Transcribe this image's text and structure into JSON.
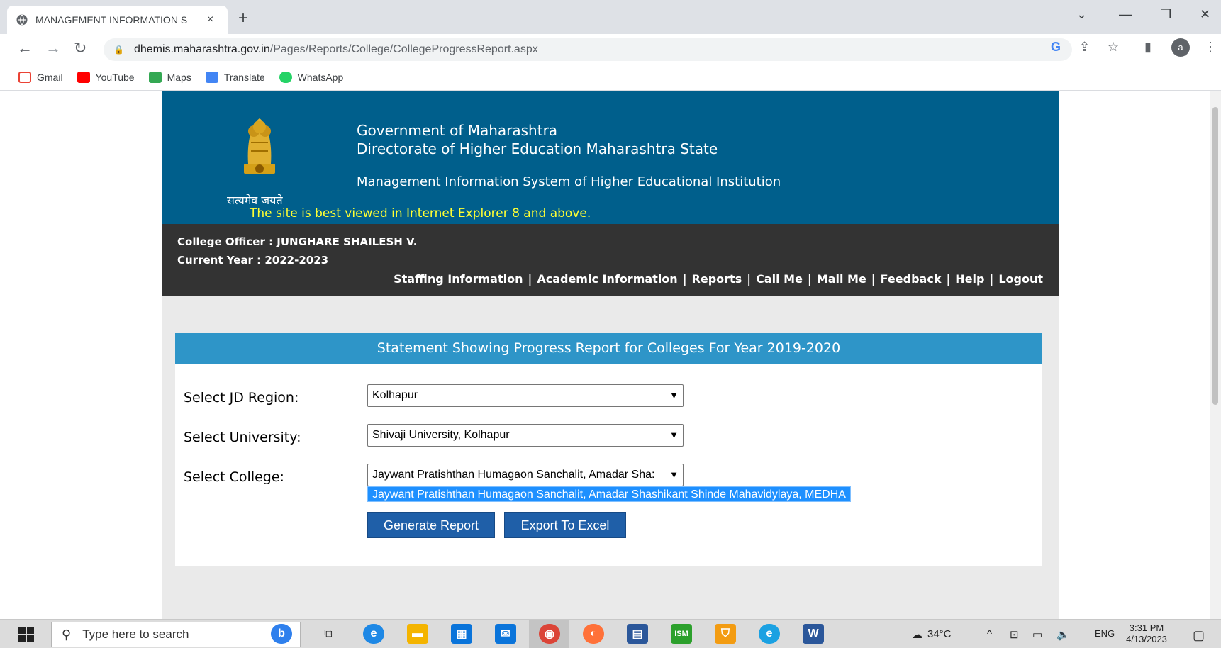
{
  "browser": {
    "tab_title": "MANAGEMENT INFORMATION S",
    "tab_close": "×",
    "new_tab": "+",
    "url_host": "dhemis.maharashtra.gov.in",
    "url_path": "/Pages/Reports/College/CollegeProgressReport.aspx",
    "bookmarks": [
      "Gmail",
      "YouTube",
      "Maps",
      "Translate",
      "WhatsApp"
    ],
    "profile_initial": "a"
  },
  "header": {
    "line1": "Government of Maharashtra",
    "line2": "Directorate of Higher Education Maharashtra State",
    "line3": "Management Information System of Higher Educational Institution",
    "motto": "सत्यमेव जयते",
    "best_view": "The site is best viewed in Internet Explorer 8 and above."
  },
  "userbar": {
    "officer": "College Officer : JUNGHARE SHAILESH V.",
    "year": "Current Year : 2022-2023",
    "nav": [
      "Staffing Information",
      "Academic Information",
      "Reports",
      "Call Me",
      "Mail Me",
      "Feedback",
      "Help",
      "Logout"
    ],
    "separator": "|"
  },
  "report": {
    "heading": "Statement Showing Progress Report for Colleges For Year 2019-2020",
    "jd_label": "Select JD Region:",
    "jd_value": "Kolhapur",
    "univ_label": "Select University:",
    "univ_value": "Shivaji University, Kolhapur",
    "college_label": "Select College:",
    "college_value": "Jaywant Pratishthan Humagaon Sanchalit, Amadar Sha:",
    "college_option": "Jaywant Pratishthan Humagaon Sanchalit, Amadar Shashikant Shinde Mahavidylaya, MEDHA",
    "generate_btn": "Generate Report",
    "export_btn": "Export To Excel"
  },
  "taskbar": {
    "search_placeholder": "Type here to search",
    "temperature": "34°C",
    "language": "ENG",
    "time": "3:31 PM",
    "date": "4/13/2023"
  },
  "colors": {
    "banner": "#005f8c",
    "userbar": "#333333",
    "panel_head": "#2e95c8",
    "button": "#1f5fa8",
    "highlight_text": "#ffff33"
  }
}
